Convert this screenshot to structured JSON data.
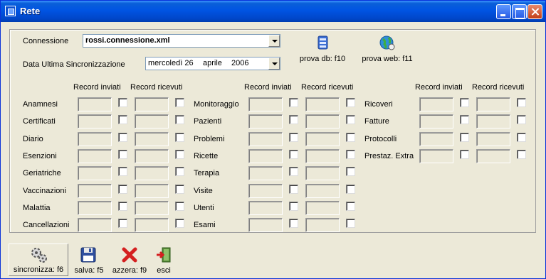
{
  "window": {
    "title": "Rete"
  },
  "connection": {
    "label": "Connessione",
    "value": "rossi.connessione.xml"
  },
  "sync_date": {
    "label": "Data Ultima Sincronizzazione",
    "day": "mercoledì 26",
    "month": "aprile",
    "year": "2006"
  },
  "tools": {
    "db_label": "prova db: f10",
    "web_label": "prova web: f11"
  },
  "columns": {
    "sent": "Record inviati",
    "received": "Record ricevuti"
  },
  "groups": [
    {
      "rows": [
        "Anamnesi",
        "Certificati",
        "Diario",
        "Esenzioni",
        "Geriatriche",
        "Vaccinazioni",
        "Malattia",
        "Cancellazioni"
      ]
    },
    {
      "rows": [
        "Monitoraggio",
        "Pazienti",
        "Problemi",
        "Ricette",
        "Terapia",
        "Visite",
        "Utenti",
        "Esami"
      ]
    },
    {
      "rows": [
        "Ricoveri",
        "Fatture",
        "Protocolli",
        "Prestaz. Extra"
      ]
    }
  ],
  "toolbar": {
    "sync": "sincronizza: f6",
    "save": "salva: f5",
    "reset": "azzera: f9",
    "exit": "esci"
  }
}
